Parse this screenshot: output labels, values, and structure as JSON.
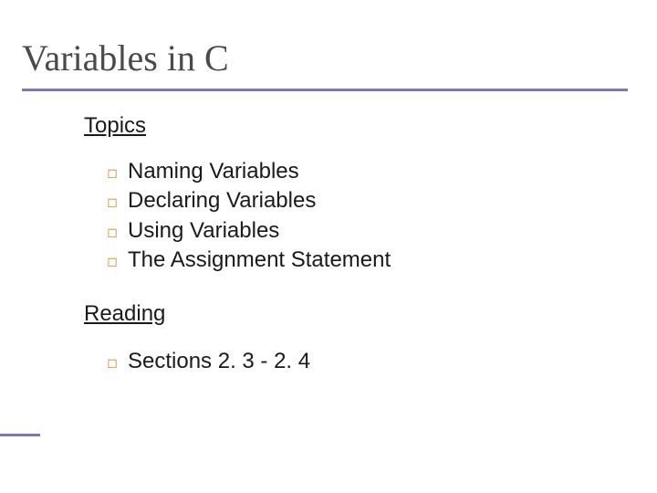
{
  "title": "Variables in C",
  "sections": [
    {
      "heading": "Topics",
      "items": [
        "Naming Variables",
        "Declaring Variables",
        "Using Variables",
        "The Assignment Statement"
      ]
    },
    {
      "heading": "Reading",
      "items": [
        "Sections 2. 3 - 2. 4"
      ]
    }
  ],
  "bullet_glyph": "◻"
}
